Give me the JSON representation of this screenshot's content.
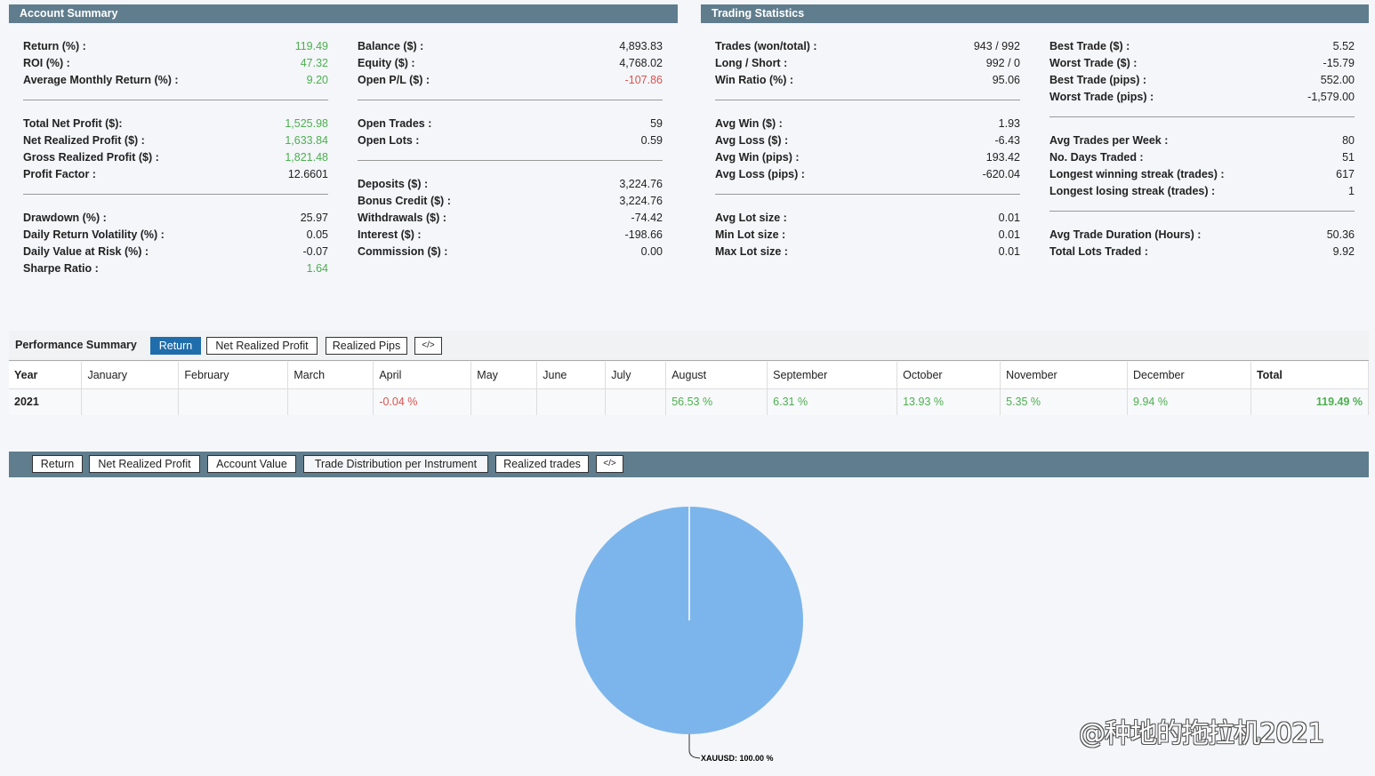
{
  "account_summary": {
    "title": "Account Summary",
    "col1": [
      [
        {
          "label": "Return (%) :",
          "value": "119.49",
          "color": "pos"
        },
        {
          "label": "ROI (%) :",
          "value": "47.32",
          "color": "pos"
        },
        {
          "label": "Average Monthly Return (%) :",
          "value": "9.20",
          "color": "pos"
        }
      ],
      [
        {
          "label": "Total Net Profit ($):",
          "value": "1,525.98",
          "color": "pos"
        },
        {
          "label": "Net Realized Profit ($) :",
          "value": "1,633.84",
          "color": "pos"
        },
        {
          "label": "Gross Realized Profit ($) :",
          "value": "1,821.48",
          "color": "pos"
        },
        {
          "label": "Profit Factor :",
          "value": "12.6601",
          "color": ""
        }
      ],
      [
        {
          "label": "Drawdown (%) :",
          "value": "25.97",
          "color": ""
        },
        {
          "label": "Daily Return Volatility (%) :",
          "value": "0.05",
          "color": ""
        },
        {
          "label": "Daily Value at Risk (%) :",
          "value": "-0.07",
          "color": ""
        },
        {
          "label": "Sharpe Ratio :",
          "value": "1.64",
          "color": "pos"
        }
      ]
    ],
    "col2": [
      [
        {
          "label": "Balance ($) :",
          "value": "4,893.83",
          "color": ""
        },
        {
          "label": "Equity ($) :",
          "value": "4,768.02",
          "color": ""
        },
        {
          "label": "Open P/L ($) :",
          "value": "-107.86",
          "color": "neg"
        }
      ],
      [
        {
          "label": "Open Trades :",
          "value": "59",
          "color": ""
        },
        {
          "label": "Open Lots :",
          "value": "0.59",
          "color": ""
        }
      ],
      [
        {
          "label": "Deposits ($) :",
          "value": "3,224.76",
          "color": ""
        },
        {
          "label": "Bonus Credit ($) :",
          "value": "3,224.76",
          "color": ""
        },
        {
          "label": "Withdrawals ($) :",
          "value": "-74.42",
          "color": ""
        },
        {
          "label": "Interest ($) :",
          "value": "-198.66",
          "color": ""
        },
        {
          "label": "Commission ($) :",
          "value": "0.00",
          "color": ""
        }
      ]
    ]
  },
  "trading_statistics": {
    "title": "Trading Statistics",
    "col1": [
      [
        {
          "label": "Trades (won/total) :",
          "value": "943 / 992",
          "color": ""
        },
        {
          "label": "Long / Short :",
          "value": "992 / 0",
          "color": ""
        },
        {
          "label": "Win Ratio (%) :",
          "value": "95.06",
          "color": ""
        }
      ],
      [
        {
          "label": "Avg Win ($) :",
          "value": "1.93",
          "color": ""
        },
        {
          "label": "Avg Loss ($) :",
          "value": "-6.43",
          "color": ""
        },
        {
          "label": "Avg Win (pips) :",
          "value": "193.42",
          "color": ""
        },
        {
          "label": "Avg Loss (pips) :",
          "value": "-620.04",
          "color": ""
        }
      ],
      [
        {
          "label": "Avg Lot size :",
          "value": "0.01",
          "color": ""
        },
        {
          "label": "Min Lot size :",
          "value": "0.01",
          "color": ""
        },
        {
          "label": "Max Lot size :",
          "value": "0.01",
          "color": ""
        }
      ]
    ],
    "col2": [
      [
        {
          "label": "Best Trade ($) :",
          "value": "5.52",
          "color": ""
        },
        {
          "label": "Worst Trade ($) :",
          "value": "-15.79",
          "color": ""
        },
        {
          "label": "Best Trade (pips) :",
          "value": "552.00",
          "color": ""
        },
        {
          "label": "Worst Trade (pips) :",
          "value": "-1,579.00",
          "color": ""
        }
      ],
      [
        {
          "label": "Avg Trades per Week :",
          "value": "80",
          "color": ""
        },
        {
          "label": "No. Days Traded :",
          "value": "51",
          "color": ""
        },
        {
          "label": "Longest winning streak (trades) :",
          "value": "617",
          "color": ""
        },
        {
          "label": "Longest losing streak (trades) :",
          "value": "1",
          "color": ""
        }
      ],
      [
        {
          "label": "Avg Trade Duration (Hours) :",
          "value": "50.36",
          "color": ""
        },
        {
          "label": "Total Lots Traded :",
          "value": "9.92",
          "color": ""
        }
      ]
    ]
  },
  "performance": {
    "title": "Performance Summary",
    "tabs": [
      "Return",
      "Net Realized Profit",
      "Realized Pips",
      "</>"
    ],
    "active_tab": 0,
    "headers": [
      "Year",
      "January",
      "February",
      "March",
      "April",
      "May",
      "June",
      "July",
      "August",
      "September",
      "October",
      "November",
      "December",
      "Total"
    ],
    "rows": [
      {
        "cells": [
          "2021",
          "",
          "",
          "",
          "-0.04 %",
          "",
          "",
          "",
          "56.53 %",
          "6.31 %",
          "13.93 %",
          "5.35 %",
          "9.94 %",
          "119.49 %"
        ],
        "colors": [
          "",
          "",
          "",
          "",
          "neg",
          "",
          "",
          "",
          "pos",
          "pos",
          "pos",
          "pos",
          "pos",
          "pos"
        ]
      }
    ]
  },
  "chart_tabs": {
    "tabs": [
      "Return",
      "Net Realized Profit",
      "Account Value",
      "Trade Distribution per Instrument",
      "Realized trades",
      "</>"
    ],
    "active_tab": 3
  },
  "chart_data": {
    "type": "pie",
    "title": "",
    "slices": [
      {
        "label": "XAUUSD",
        "value": 100.0,
        "display": "XAUUSD: 100.00 %",
        "color": "#7cb5ec"
      }
    ]
  },
  "watermark": "@种地的拖拉机2021",
  "colors": {
    "header": "#607d8e",
    "positive": "#4caf50",
    "negative": "#d9534f",
    "active_tab": "#1f6dab",
    "pie": "#7cb5ec"
  }
}
